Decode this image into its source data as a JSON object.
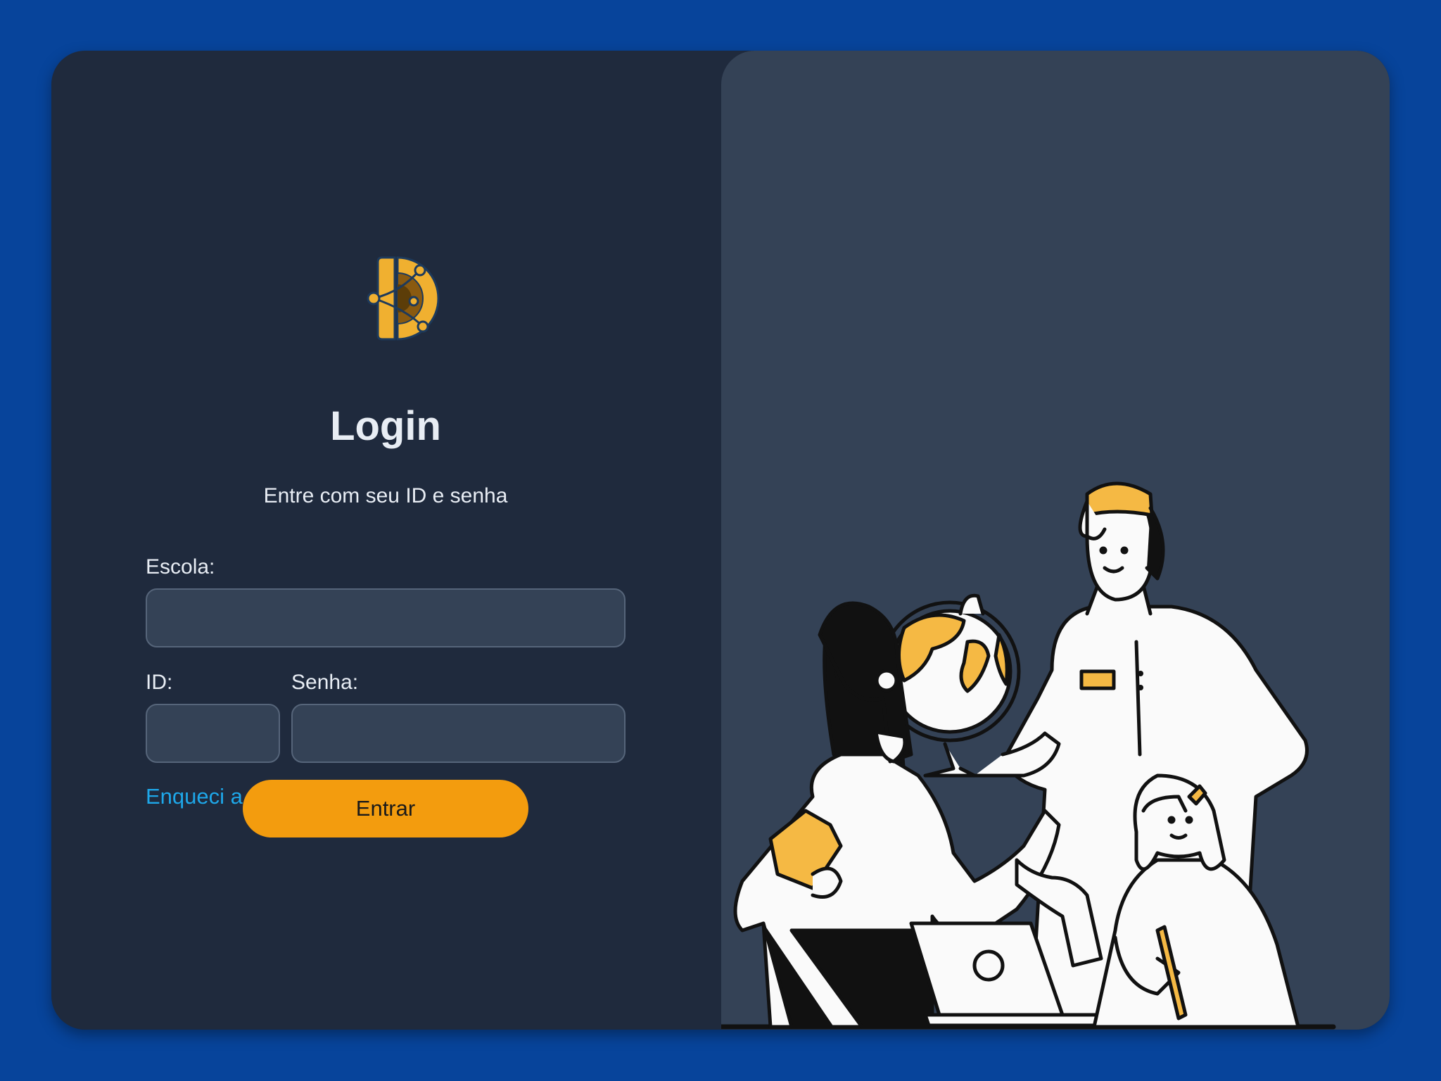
{
  "login": {
    "title": "Login",
    "subtitle": "Entre com seu ID e senha",
    "school_label": "Escola:",
    "school_value": "",
    "id_label": "ID:",
    "id_value": "",
    "password_label": "Senha:",
    "password_value": "",
    "forgot_link": "Enqueci a senha",
    "submit_label": "Entrar"
  },
  "icons": {
    "logo": "orbit-d-logo",
    "illustration": "students-with-globe-illustration"
  },
  "colors": {
    "page_background": "#07449b",
    "card_background": "#1f2a3d",
    "illustration_panel": "#344256",
    "accent": "#f39c0e",
    "link": "#1ea7e9",
    "input_background": "#344256",
    "text": "#e8edf4"
  }
}
